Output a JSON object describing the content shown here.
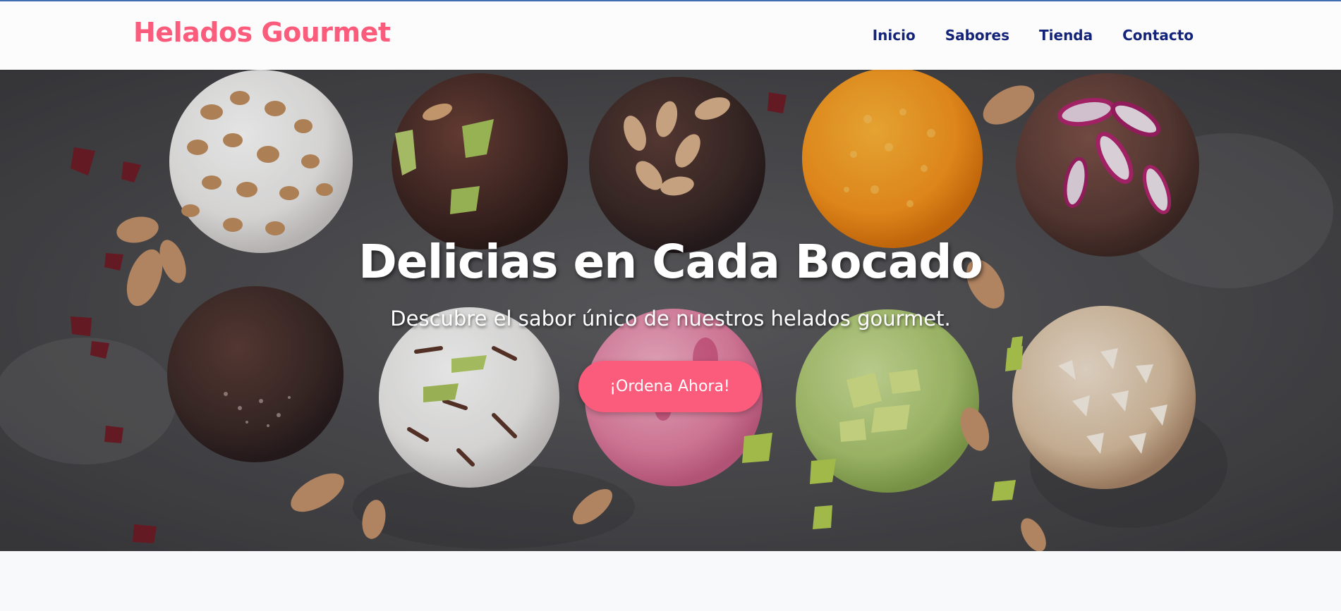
{
  "brand": {
    "name": "Helados Gourmet",
    "color": "#fb5c7c"
  },
  "nav": {
    "items": [
      {
        "label": "Inicio"
      },
      {
        "label": "Sabores"
      },
      {
        "label": "Tienda"
      },
      {
        "label": "Contacto"
      }
    ],
    "color": "#14237a"
  },
  "hero": {
    "title": "Delicias en Cada Bocado",
    "subtitle": "Descubre el sabor único de nuestros helados gourmet.",
    "cta_label": "¡Ordena Ahora!",
    "cta_color": "#fb5c7c",
    "background_image": "photo of assorted gourmet ice cream balls with toppings on dark stone surface"
  }
}
